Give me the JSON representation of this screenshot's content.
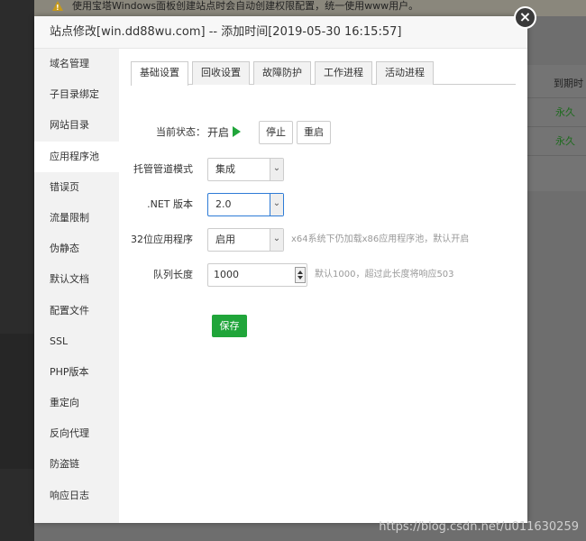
{
  "background": {
    "notice": "使用宝塔Windows面板创建站点时会自动创建权限配置，统一使用www用户。",
    "column_header": "到期时",
    "rows": [
      "永久",
      "永久"
    ],
    "watermark": "https://blog.csdn.net/u011630259"
  },
  "dialog": {
    "title": "站点修改[win.dd88wu.com] -- 添加时间[2019-05-30 16:15:57]",
    "close_label": "×"
  },
  "sidebar": {
    "items": [
      {
        "label": "域名管理"
      },
      {
        "label": "子目录绑定"
      },
      {
        "label": "网站目录"
      },
      {
        "label": "应用程序池"
      },
      {
        "label": "错误页"
      },
      {
        "label": "流量限制"
      },
      {
        "label": "伪静态"
      },
      {
        "label": "默认文档"
      },
      {
        "label": "配置文件"
      },
      {
        "label": "SSL"
      },
      {
        "label": "PHP版本"
      },
      {
        "label": "重定向"
      },
      {
        "label": "反向代理"
      },
      {
        "label": "防盗链"
      },
      {
        "label": "响应日志"
      }
    ],
    "active_index": 3
  },
  "tabs": [
    {
      "label": "基础设置"
    },
    {
      "label": "回收设置"
    },
    {
      "label": "故障防护"
    },
    {
      "label": "工作进程"
    },
    {
      "label": "活动进程"
    }
  ],
  "form": {
    "status_label": "当前状态：",
    "status_value": "开启",
    "stop_label": "停止",
    "restart_label": "重启",
    "pipeline_label": "托管管道模式",
    "pipeline_value": "集成",
    "net_label": ".NET 版本",
    "net_value": "2.0",
    "app32_label": "32位应用程序",
    "app32_value": "启用",
    "app32_hint": "x64系统下仍加载x86应用程序池，默认开启",
    "queue_label": "队列长度",
    "queue_value": "1000",
    "queue_hint": "默认1000，超过此长度将响应503",
    "save_label": "保存"
  },
  "colors": {
    "accent_green": "#20a53a",
    "focus_blue": "#2e7bd6"
  }
}
